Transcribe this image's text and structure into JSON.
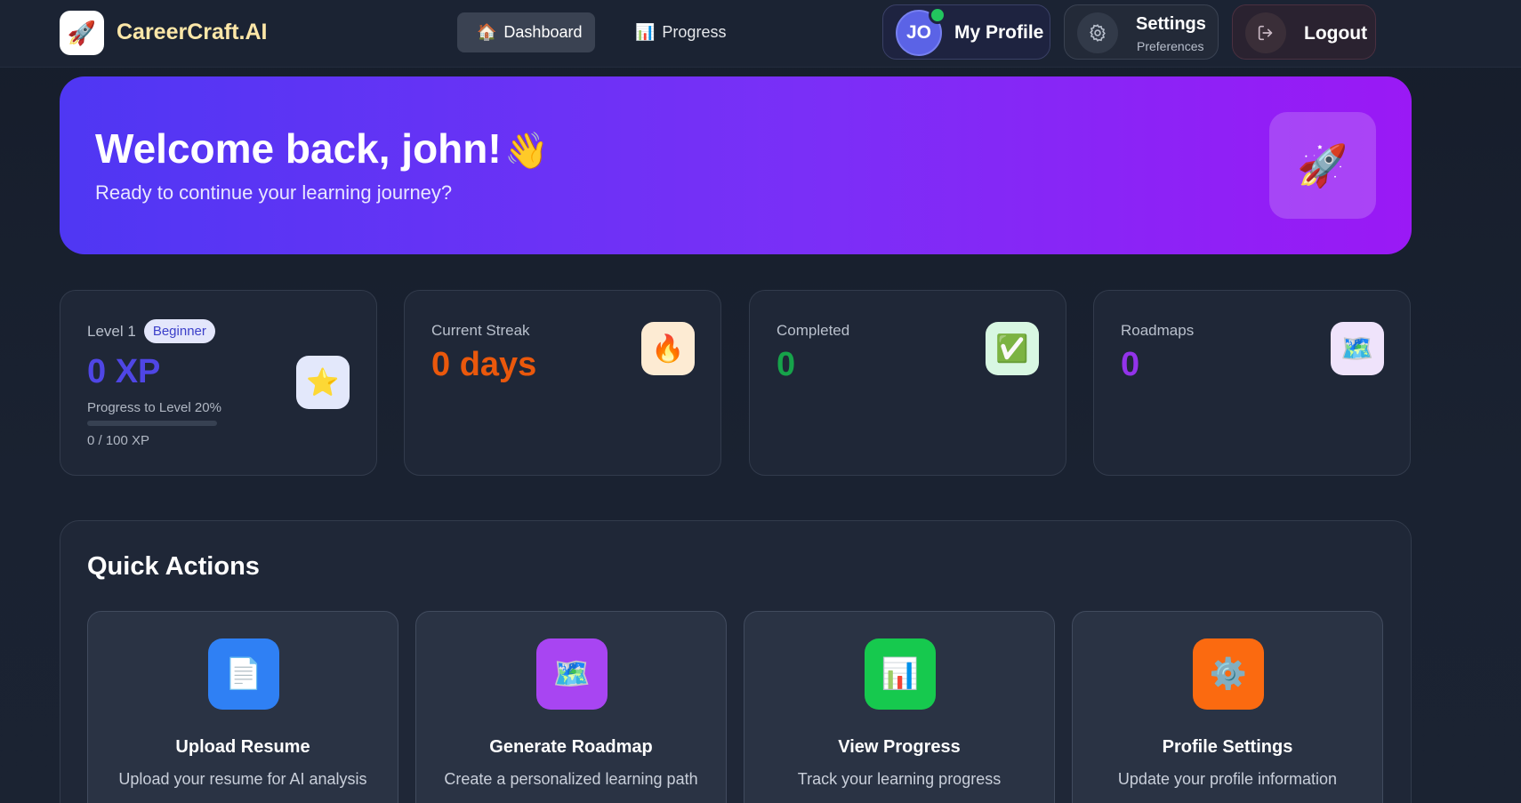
{
  "brand": {
    "logo_icon": "rocket-icon",
    "name": "CareerCraft.AI"
  },
  "nav": {
    "dashboard": {
      "icon": "🏠",
      "label": "Dashboard",
      "active": true
    },
    "progress": {
      "icon": "📊",
      "label": "Progress",
      "active": false
    }
  },
  "profile": {
    "initials": "JO",
    "label": "My Profile",
    "online": true
  },
  "settings": {
    "title": "Settings",
    "subtitle": "Preferences",
    "icon": "gear-icon"
  },
  "logout": {
    "label": "Logout",
    "icon": "logout-icon"
  },
  "hero": {
    "title": "Welcome back, john!",
    "emoji": "👋",
    "subtitle": "Ready to continue your learning journey?",
    "badge_emoji": "🚀"
  },
  "stats": {
    "level": {
      "label": "Level 1",
      "badge": "Beginner",
      "xp": "0 XP",
      "progress_label": "Progress to Level 20%",
      "progress_fraction": 0,
      "xp_count": "0 / 100 XP",
      "icon": "⭐"
    },
    "streak": {
      "label": "Current Streak",
      "value": "0 days",
      "icon": "🔥",
      "color": "#ea580c"
    },
    "completed": {
      "label": "Completed",
      "value": "0",
      "icon": "✅",
      "color": "#16a34a"
    },
    "roadmaps": {
      "label": "Roadmaps",
      "value": "0",
      "icon": "🗺️",
      "color": "#9333ea"
    }
  },
  "quick_actions": {
    "title": "Quick Actions",
    "items": [
      {
        "title": "Upload Resume",
        "desc": "Upload your resume for AI analysis",
        "icon": "📄",
        "color": "#2f80f4"
      },
      {
        "title": "Generate Roadmap",
        "desc": "Create a personalized learning path",
        "icon": "🗺️",
        "color": "#a845f2"
      },
      {
        "title": "View Progress",
        "desc": "Track your learning progress",
        "icon": "📊",
        "color": "#16c94e"
      },
      {
        "title": "Profile Settings",
        "desc": "Update your profile information",
        "icon": "⚙️",
        "color": "#fb6a10"
      }
    ]
  }
}
